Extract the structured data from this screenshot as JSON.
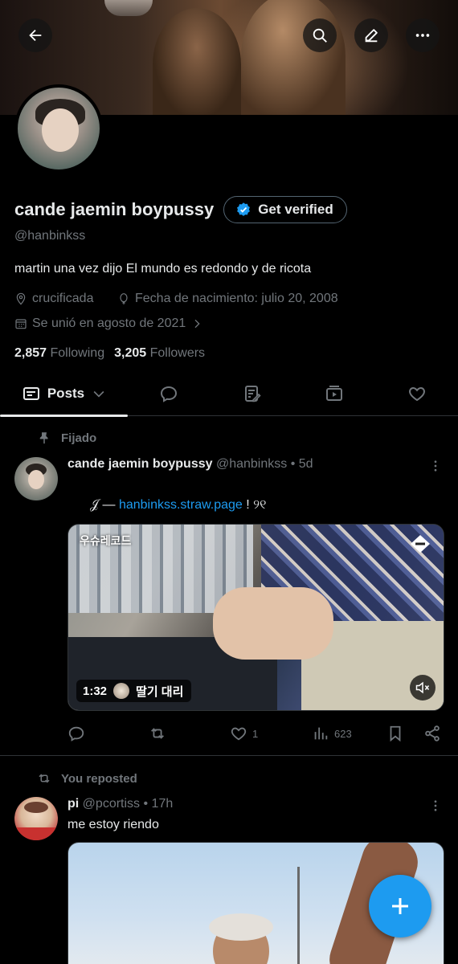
{
  "profile": {
    "display_name": "cande jaemin boypussy",
    "verify_label": "Get verified",
    "handle": "@hanbinkss",
    "bio": "martin una vez dijo El mundo es redondo y de ricota",
    "location": "crucificada",
    "birthdate": "Fecha de nacimiento: julio 20, 2008",
    "joined": "Se unió en agosto de 2021",
    "following_count": "2,857",
    "following_label": "Following",
    "followers_count": "3,205",
    "followers_label": "Followers"
  },
  "tabs": {
    "posts_label": "Posts",
    "items": [
      "posts",
      "replies",
      "articles",
      "media",
      "likes"
    ]
  },
  "posts": [
    {
      "context": "Fijado",
      "author": "cande jaemin boypussy",
      "handle": "@hanbinkss",
      "time": "• 5d",
      "text_prefix": "𝒥  —  ",
      "link": "hanbinkss.straw.page",
      "text_suffix": "  !   ୨୧",
      "media": {
        "overlay_title": "우슈레코드",
        "duration": "1:32",
        "channel": "딸기 대리"
      },
      "likes": "1",
      "views": "623"
    },
    {
      "context": "You reposted",
      "author": "pi",
      "handle": "@pcortiss",
      "time": "• 17h",
      "text": "me estoy riendo"
    }
  ],
  "colors": {
    "accent": "#1d9bf0",
    "background": "#000000",
    "text": "#e7e9ea",
    "muted": "#71767b",
    "border": "#2f3336"
  },
  "icons": {
    "header": [
      "back-arrow-icon",
      "search-icon",
      "edit-icon",
      "more-icon"
    ],
    "fab": "plus-icon"
  }
}
